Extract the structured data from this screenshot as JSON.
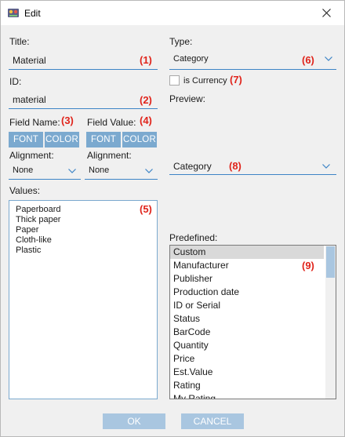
{
  "window": {
    "title": "Edit"
  },
  "left": {
    "title_label": "Title:",
    "title_value": "Material",
    "title_ann": "(1)",
    "id_label": "ID:",
    "id_value": "material",
    "id_ann": "(2)",
    "field_name_label": "Field Name:",
    "field_name_ann": "(3)",
    "field_value_label": "Field Value:",
    "field_value_ann": "(4)",
    "font_btn": "FONT",
    "color_btn": "COLOR",
    "alignment_label": "Alignment:",
    "alignment_value": "None",
    "values_label": "Values:",
    "values_ann": "(5)",
    "values": [
      "Paperboard",
      "Thick paper",
      "Paper",
      "Cloth-like",
      "Plastic"
    ]
  },
  "right": {
    "type_label": "Type:",
    "type_value": "Category",
    "type_ann": "(6)",
    "is_currency_label": "is Currency",
    "is_currency_ann": "(7)",
    "is_currency_checked": false,
    "preview_label": "Preview:",
    "preview_value": "Category",
    "preview_ann": "(8)",
    "predefined_label": "Predefined:",
    "predefined_ann": "(9)",
    "predefined_items": [
      "Custom",
      "Manufacturer",
      "Publisher",
      "Production date",
      "ID or Serial",
      "Status",
      "BarCode",
      "Quantity",
      "Price",
      "Est.Value",
      "Rating",
      "My Rating"
    ],
    "selected_index": 0
  },
  "footer": {
    "ok": "OK",
    "cancel": "CANCEL"
  },
  "colors": {
    "accent": "#3d84c6",
    "button": "#7ba9cf",
    "annotation": "#e0241b"
  }
}
